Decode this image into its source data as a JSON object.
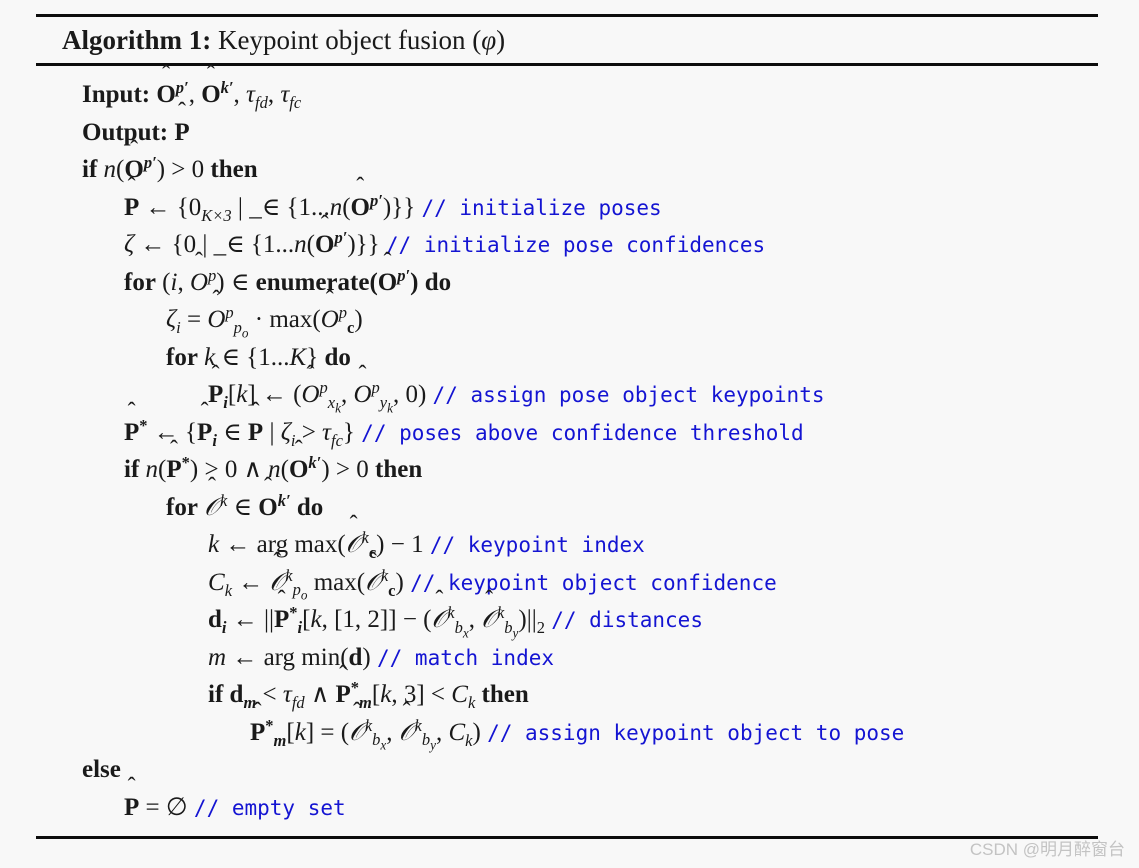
{
  "document": {
    "kind": "algorithm-float",
    "background_color": "#f8f8f8",
    "text_color": "#1a1a1a",
    "comment_color": "#1414d2",
    "rule_color": "#0d0d0d"
  },
  "header": {
    "label": "Algorithm 1:",
    "caption": "Keypoint object fusion (φ)",
    "caption_plain": "Keypoint object fusion",
    "caption_symbol": "φ"
  },
  "lines": [
    {
      "id": "input",
      "indent": 0,
      "kind": "io",
      "keyword": "Input:",
      "text": "Input: Ô^{p′}, Ô^{k′}, τ_{fd}, τ_{fc}",
      "comment": ""
    },
    {
      "id": "output",
      "indent": 0,
      "kind": "io",
      "keyword": "Output:",
      "text": "Output: P̂",
      "comment": ""
    },
    {
      "id": "if-poses",
      "indent": 0,
      "kind": "if",
      "text": "if n(Ô^{p′}) > 0 then",
      "comment": ""
    },
    {
      "id": "init-poses",
      "indent": 1,
      "kind": "assign",
      "text": "P̂ ← {0_{K×3} | _ ∈ {1...n(Ô^{p′})}}",
      "comment": "// initialize poses"
    },
    {
      "id": "init-pose-confidences",
      "indent": 1,
      "kind": "assign",
      "text": "ζ ← {0 | _ ∈ {1...n(Ô^{p′})}}",
      "comment": "// initialize pose confidences"
    },
    {
      "id": "for-enumerate",
      "indent": 1,
      "kind": "for",
      "text": "for (i, Ô^{p}) ∈ enumerate(Ô^{p′}) do",
      "comment": ""
    },
    {
      "id": "zeta-assign",
      "indent": 2,
      "kind": "assign",
      "text": "ζ_i = Ô^{p}_{p_o} · max(Ô^{p}_{c})",
      "comment": ""
    },
    {
      "id": "for-keypoints",
      "indent": 2,
      "kind": "for",
      "text": "for k ∈ {1...K} do",
      "comment": ""
    },
    {
      "id": "assign-pose-keypoints",
      "indent": 3,
      "kind": "assign",
      "text": "P̂_i[k] ← (Ô^{p}_{x_k}, Ô^{p}_{y_k}, 0)",
      "comment": "// assign pose object keypoints"
    },
    {
      "id": "filter-poses",
      "indent": 1,
      "kind": "assign",
      "text": "P̂* ← {P̂_i ∈ P̂ | ζ_i > τ_{fc}}",
      "comment": "// poses above confidence threshold"
    },
    {
      "id": "if-both-nonempty",
      "indent": 1,
      "kind": "if",
      "text": "if n(P̂*) > 0 ∧ n(Ô^{k′}) > 0 then",
      "comment": ""
    },
    {
      "id": "for-keypoint-objects",
      "indent": 2,
      "kind": "for",
      "text": "for Ô^{k} ∈ Ô^{k′} do",
      "comment": ""
    },
    {
      "id": "keypoint-index",
      "indent": 3,
      "kind": "assign",
      "text": "k ← arg max(Ô^{k}_{c}) − 1",
      "comment": "// keypoint index"
    },
    {
      "id": "keypoint-object-confidence",
      "indent": 3,
      "kind": "assign",
      "text": "C_k ← Ô^{k}_{p_o} max(Ô^{k}_{c})",
      "comment": "// keypoint object confidence"
    },
    {
      "id": "distances",
      "indent": 3,
      "kind": "assign",
      "text": "d_i ← ||P̂*_i[k, [1, 2]] − (Ô^{k}_{b_x}, Ô^{k}_{b_y})||_2",
      "comment": "// distances"
    },
    {
      "id": "match-index",
      "indent": 3,
      "kind": "assign",
      "text": "m ← arg min(d)",
      "comment": "// match index"
    },
    {
      "id": "if-match-valid",
      "indent": 3,
      "kind": "if",
      "text": "if d_m < τ_{fd} ∧ P̂*_m[k, 3] < C_k then",
      "comment": ""
    },
    {
      "id": "assign-keypoint-object",
      "indent": 5,
      "kind": "assign",
      "text": "P̂*_m[k] = (Ô^{k}_{b_x}, Ô^{k}_{b_y}, C_k)",
      "comment": "// assign keypoint object to pose"
    },
    {
      "id": "else",
      "indent": 0,
      "kind": "else",
      "text": "else",
      "comment": ""
    },
    {
      "id": "empty-set",
      "indent": 1,
      "kind": "assign",
      "text": "P̂ = ∅",
      "comment": "// empty set"
    }
  ],
  "comments": {
    "initialize_poses": "// initialize poses",
    "initialize_pose_confidences": "// initialize pose confidences",
    "assign_pose_object_keypoints": "// assign pose object keypoints",
    "poses_above_confidence_threshold": "// poses above confidence threshold",
    "keypoint_index": "// keypoint index",
    "keypoint_object_confidence": "// keypoint object confidence",
    "distances": "// distances",
    "match_index": "// match index",
    "assign_keypoint_object_to_pose": "// assign keypoint object to pose",
    "empty_set": "// empty set"
  },
  "keywords": {
    "input": "Input:",
    "output": "Output:",
    "if": "if",
    "then": "then",
    "else": "else",
    "for": "for",
    "do": "do",
    "enumerate": "enumerate",
    "max": "max",
    "min": "min",
    "arg": "arg"
  },
  "watermark": {
    "text": "CSDN @明月醉窗台"
  }
}
